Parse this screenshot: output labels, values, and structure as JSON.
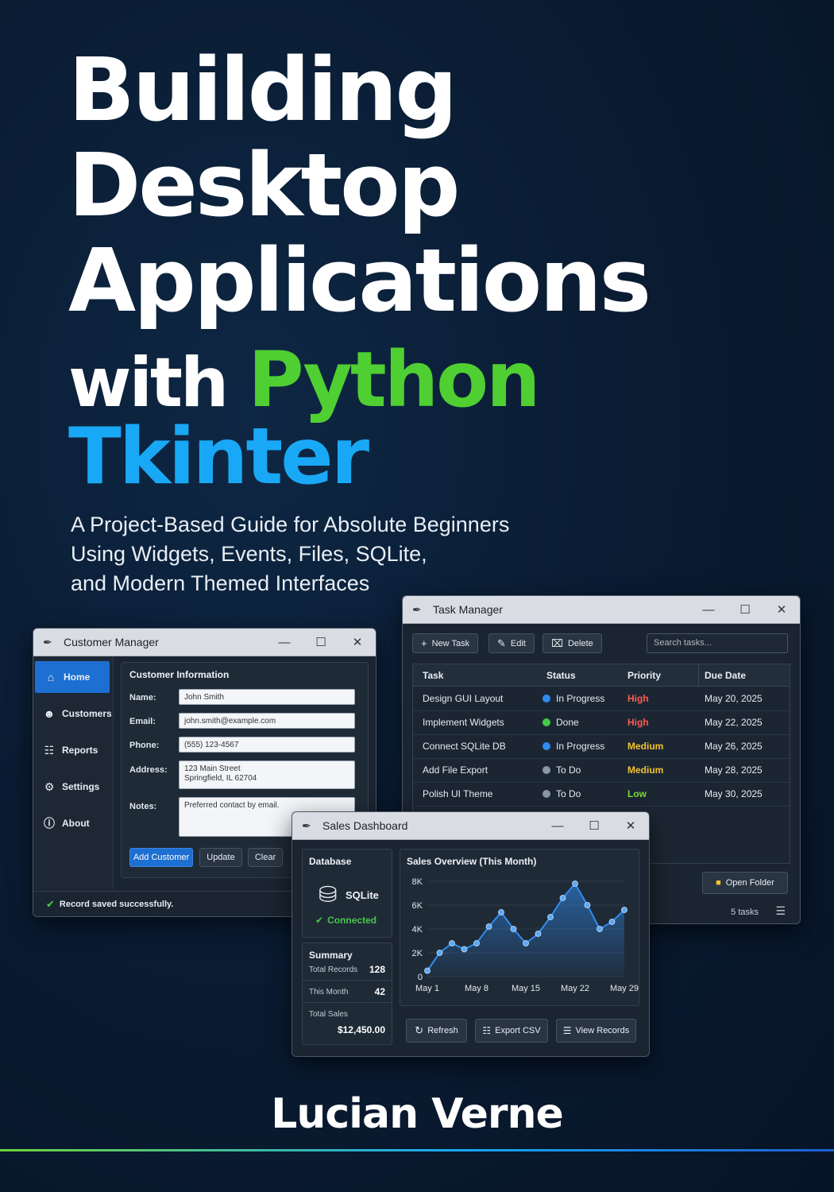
{
  "cover": {
    "title_line1": "Building",
    "title_line2": "Desktop",
    "title_line3": "Applications",
    "title_with": "with ",
    "title_python": "Python",
    "title_tkinter": "Tkinter",
    "subtitle_lines": [
      "A Project-Based Guide for Absolute Beginners",
      "Using Widgets, Events, Files, SQLite,",
      "and Modern Themed Interfaces"
    ],
    "author": "Lucian Verne",
    "colors": {
      "python_green": "#4fcf32",
      "tkinter_blue": "#19a8f5",
      "background": "#0a1c33"
    }
  },
  "customer_manager": {
    "title": "Customer Manager",
    "nav": [
      {
        "label": "Home",
        "icon": "home-icon",
        "active": true
      },
      {
        "label": "Customers",
        "icon": "users-icon"
      },
      {
        "label": "Reports",
        "icon": "reports-icon"
      },
      {
        "label": "Settings",
        "icon": "gear-icon"
      },
      {
        "label": "About",
        "icon": "info-icon"
      }
    ],
    "section_title": "Customer Information",
    "fields": {
      "name_label": "Name:",
      "name_value": "John Smith",
      "email_label": "Email:",
      "email_value": "john.smith@example.com",
      "phone_label": "Phone:",
      "phone_value": "(555) 123-4567",
      "address_label": "Address:",
      "address_line1": "123 Main Street",
      "address_line2": "Springfield, IL 62704",
      "notes_label": "Notes:",
      "notes_value": "Preferred contact by email."
    },
    "buttons": {
      "add": "Add Customer",
      "update": "Update",
      "clear": "Clear"
    },
    "status": "Record saved successfully."
  },
  "task_manager": {
    "title": "Task Manager",
    "toolbar": {
      "new_task": "New Task",
      "edit": "Edit",
      "delete": "Delete",
      "search_placeholder": "Search tasks..."
    },
    "columns": [
      "Task",
      "Status",
      "Priority",
      "Due Date"
    ],
    "rows": [
      {
        "task": "Design GUI Layout",
        "status": "In Progress",
        "status_color": "#2f8cf0",
        "priority": "High",
        "priority_color": "#ff5a52",
        "due": "May 20, 2025"
      },
      {
        "task": "Implement Widgets",
        "status": "Done",
        "status_color": "#47c84a",
        "priority": "High",
        "priority_color": "#ff5a52",
        "due": "May 22, 2025"
      },
      {
        "task": "Connect SQLite DB",
        "status": "In Progress",
        "status_color": "#2f8cf0",
        "priority": "Medium",
        "priority_color": "#f2c230",
        "due": "May 26, 2025"
      },
      {
        "task": "Add File Export",
        "status": "To Do",
        "status_color": "#8a96a3",
        "priority": "Medium",
        "priority_color": "#f2c230",
        "due": "May 28, 2025"
      },
      {
        "task": "Polish UI Theme",
        "status": "To Do",
        "status_color": "#8a96a3",
        "priority": "Low",
        "priority_color": "#7ddc3a",
        "due": "May 30, 2025"
      }
    ],
    "open_folder": "Open Folder",
    "task_count": "5 tasks"
  },
  "sales_dashboard": {
    "title": "Sales Dashboard",
    "database": {
      "title": "Database",
      "engine": "SQLite",
      "status": "Connected"
    },
    "summary": {
      "title": "Summary",
      "total_records_label": "Total Records",
      "total_records": "128",
      "this_month_label": "This Month",
      "this_month": "42",
      "total_sales_label": "Total Sales",
      "total_sales": "$12,450.00"
    },
    "buttons": {
      "refresh": "Refresh",
      "export": "Export CSV",
      "view": "View Records"
    }
  },
  "chart_data": {
    "type": "area",
    "title": "Sales Overview (This Month)",
    "x_tick_labels": [
      "May 1",
      "May 8",
      "May 15",
      "May 22",
      "May 29"
    ],
    "y_tick_labels": [
      "0",
      "2K",
      "4K",
      "6K",
      "8K"
    ],
    "ylim": [
      0,
      8000
    ],
    "x": [
      1,
      2,
      3,
      4,
      5,
      6,
      7,
      8,
      9,
      10,
      11,
      12,
      13,
      14,
      15,
      16,
      17
    ],
    "values": [
      500,
      2000,
      2800,
      2300,
      2800,
      4200,
      5400,
      4000,
      2800,
      3600,
      5000,
      6600,
      7800,
      6000,
      4000,
      4600,
      5600
    ],
    "xlim": [
      1,
      17
    ],
    "tick_x": [
      1,
      5,
      9,
      13,
      17
    ],
    "line_color": "#2f8cf0",
    "grid": true
  }
}
